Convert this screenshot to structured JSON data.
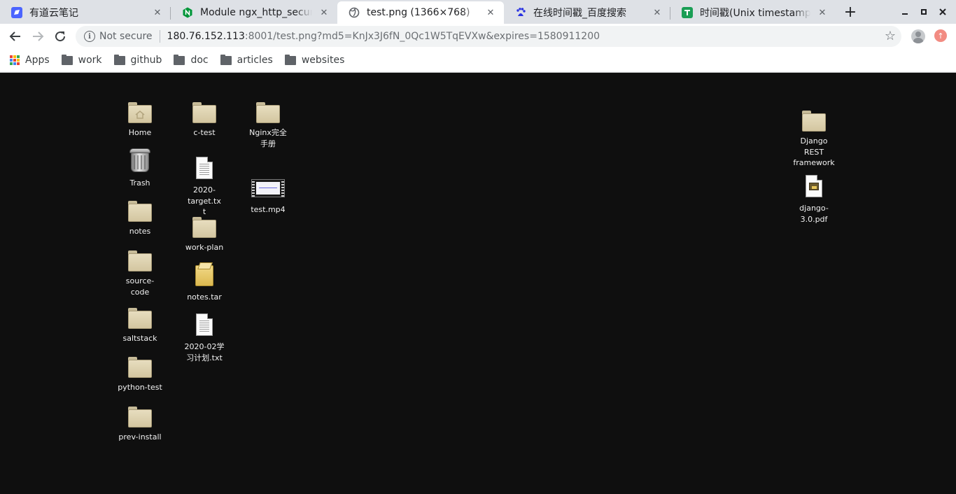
{
  "tabs": [
    {
      "title": "有道云笔记",
      "favicon": "youdao-note-icon",
      "color": "#4b64ff"
    },
    {
      "title": "Module ngx_http_secure_link_module",
      "favicon": "nginx-icon",
      "color": "#009639"
    },
    {
      "title": "test.png (1366×768)",
      "favicon": "globe-icon",
      "color": "#5f6368"
    },
    {
      "title": "在线时间戳_百度搜索",
      "favicon": "baidu-icon",
      "color": "#2932e1"
    },
    {
      "title": "时间戳(Unix timestamp)转换工具",
      "favicon": "tool-icon",
      "color": "#1a9e55"
    }
  ],
  "toolbar": {
    "security_label": "Not secure",
    "url_host": "180.76.152.113",
    "url_rest": ":8001/test.png?md5=KnJx3J6fN_0Qc1W5TqEVXw&expires=1580911200"
  },
  "bookmarks": [
    {
      "label": "Apps",
      "icon": "apps-grid-icon"
    },
    {
      "label": "work",
      "icon": "folder-icon"
    },
    {
      "label": "github",
      "icon": "folder-icon"
    },
    {
      "label": "doc",
      "icon": "folder-icon"
    },
    {
      "label": "articles",
      "icon": "folder-icon"
    },
    {
      "label": "websites",
      "icon": "folder-icon"
    }
  ],
  "desktop": {
    "icons": [
      {
        "label": "Home",
        "kind": "folder"
      },
      {
        "label": "Trash",
        "kind": "trash"
      },
      {
        "label": "notes",
        "kind": "folder"
      },
      {
        "label": "source-code",
        "kind": "folder"
      },
      {
        "label": "saltstack",
        "kind": "folder"
      },
      {
        "label": "python-test",
        "kind": "folder"
      },
      {
        "label": "prev-install",
        "kind": "folder"
      },
      {
        "label": "c-test",
        "kind": "folder"
      },
      {
        "label": "2020-target.txt",
        "kind": "text"
      },
      {
        "label": "work-plan",
        "kind": "folder"
      },
      {
        "label": "notes.tar",
        "kind": "archive"
      },
      {
        "label": "2020-02学习计划.txt",
        "kind": "text"
      },
      {
        "label": "Nginx完全手册",
        "kind": "folder"
      },
      {
        "label": "test.mp4",
        "kind": "video"
      },
      {
        "label": "Django REST framework",
        "kind": "folder"
      },
      {
        "label": "django-3.0.pdf",
        "kind": "pdf"
      }
    ]
  }
}
